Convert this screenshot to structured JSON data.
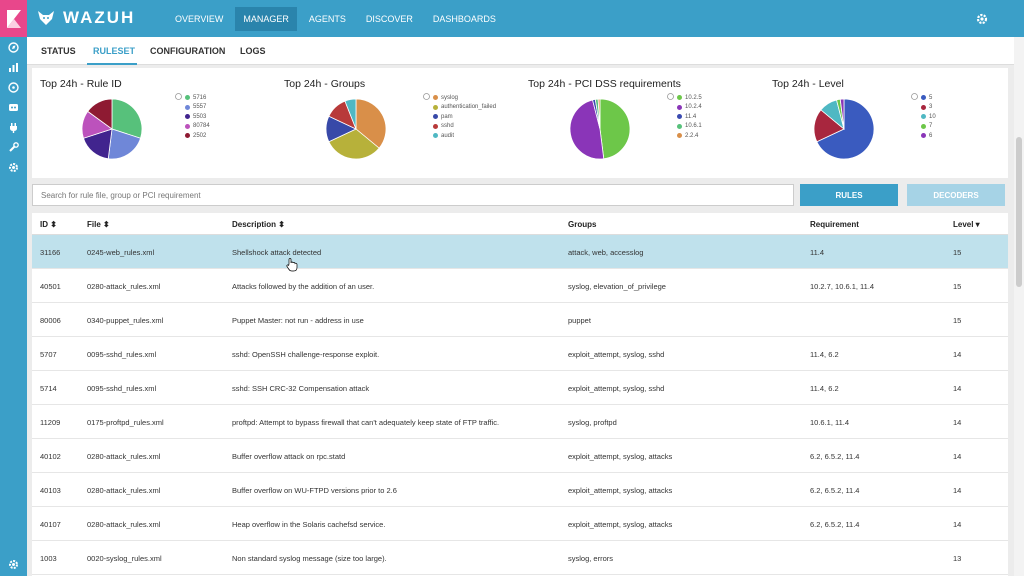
{
  "brand": {
    "name": "WAZUH"
  },
  "topnav": [
    "OVERVIEW",
    "MANAGER",
    "AGENTS",
    "DISCOVER",
    "DASHBOARDS"
  ],
  "active_top": "MANAGER",
  "subnav": [
    "STATUS",
    "RULESET",
    "CONFIGURATION",
    "LOGS"
  ],
  "active_sub": "RULESET",
  "charts": [
    {
      "title": "Top 24h - Rule ID",
      "legend": [
        "5716",
        "5557",
        "5503",
        "80784",
        "2502"
      ],
      "colors": [
        "#57c17b",
        "#6f87d8",
        "#41248e",
        "#bc52bc",
        "#8e1a32"
      ],
      "values": [
        30,
        22,
        18,
        15,
        15
      ]
    },
    {
      "title": "Top 24h - Groups",
      "legend": [
        "syslog",
        "authentication_failed",
        "pam",
        "sshd",
        "audit"
      ],
      "colors": [
        "#d98f49",
        "#b7b13a",
        "#3849a8",
        "#b83a3a",
        "#4fb8c3"
      ],
      "values": [
        36,
        32,
        14,
        12,
        6
      ]
    },
    {
      "title": "Top 24h - PCI DSS requirements",
      "legend": [
        "10.2.5",
        "10.2.4",
        "11.4",
        "10.6.1",
        "2.2.4"
      ],
      "colors": [
        "#6dc749",
        "#8a35b8",
        "#3a4ab0",
        "#57c17b",
        "#d98f49"
      ],
      "values": [
        48,
        48,
        1.5,
        1.5,
        1
      ]
    },
    {
      "title": "Top 24h - Level",
      "legend": [
        "5",
        "3",
        "10",
        "7",
        "6"
      ],
      "colors": [
        "#3a5bbf",
        "#a8263e",
        "#4fb8c3",
        "#6dc749",
        "#8a35b8"
      ],
      "values": [
        68,
        18,
        10,
        2,
        2
      ]
    }
  ],
  "search": {
    "placeholder": "Search for rule file, group or PCI requirement"
  },
  "buttons": {
    "rules": "RULES",
    "decoders": "DECODERS"
  },
  "table": {
    "headers": {
      "id": "ID ⬍",
      "file": "File ⬍",
      "desc": "Description ⬍",
      "groups": "Groups",
      "req": "Requirement",
      "level": "Level ▾"
    },
    "rows": [
      {
        "id": "31166",
        "file": "0245-web_rules.xml",
        "desc": "Shellshock attack detected",
        "groups": "attack, web, accesslog",
        "req": "11.4",
        "level": "15"
      },
      {
        "id": "40501",
        "file": "0280-attack_rules.xml",
        "desc": "Attacks followed by the addition of an user.",
        "groups": "syslog, elevation_of_privilege",
        "req": "10.2.7, 10.6.1, 11.4",
        "level": "15"
      },
      {
        "id": "80006",
        "file": "0340-puppet_rules.xml",
        "desc": "Puppet Master: not run - address in use",
        "groups": "puppet",
        "req": "",
        "level": "15"
      },
      {
        "id": "5707",
        "file": "0095-sshd_rules.xml",
        "desc": "sshd: OpenSSH challenge-response exploit.",
        "groups": "exploit_attempt, syslog, sshd",
        "req": "11.4, 6.2",
        "level": "14"
      },
      {
        "id": "5714",
        "file": "0095-sshd_rules.xml",
        "desc": "sshd: SSH CRC-32 Compensation attack",
        "groups": "exploit_attempt, syslog, sshd",
        "req": "11.4, 6.2",
        "level": "14"
      },
      {
        "id": "11209",
        "file": "0175-proftpd_rules.xml",
        "desc": "proftpd: Attempt to bypass firewall that can't adequately keep state of FTP traffic.",
        "groups": "syslog, proftpd",
        "req": "10.6.1, 11.4",
        "level": "14"
      },
      {
        "id": "40102",
        "file": "0280-attack_rules.xml",
        "desc": "Buffer overflow attack on rpc.statd",
        "groups": "exploit_attempt, syslog, attacks",
        "req": "6.2, 6.5.2, 11.4",
        "level": "14"
      },
      {
        "id": "40103",
        "file": "0280-attack_rules.xml",
        "desc": "Buffer overflow on WU-FTPD versions prior to 2.6",
        "groups": "exploit_attempt, syslog, attacks",
        "req": "6.2, 6.5.2, 11.4",
        "level": "14"
      },
      {
        "id": "40107",
        "file": "0280-attack_rules.xml",
        "desc": "Heap overflow in the Solaris cachefsd service.",
        "groups": "exploit_attempt, syslog, attacks",
        "req": "6.2, 6.5.2, 11.4",
        "level": "14"
      },
      {
        "id": "1003",
        "file": "0020-syslog_rules.xml",
        "desc": "Non standard syslog message (size too large).",
        "groups": "syslog, errors",
        "req": "",
        "level": "13"
      }
    ]
  }
}
